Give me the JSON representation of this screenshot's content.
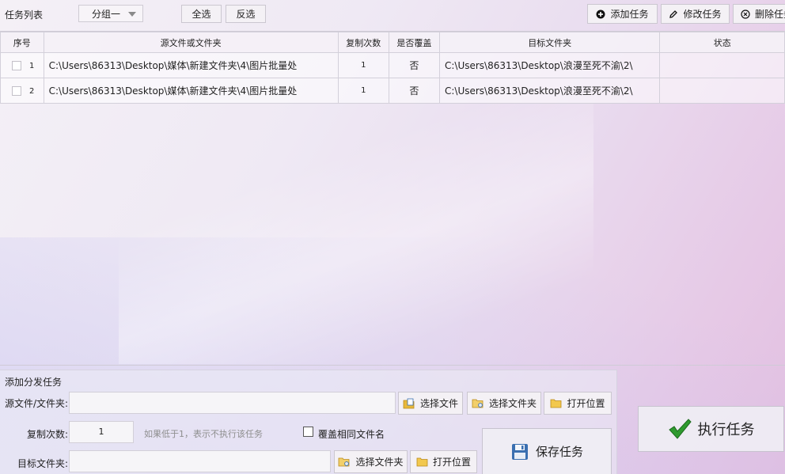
{
  "toolbar": {
    "title": "任务列表",
    "group_value": "分组一",
    "select_all": "全选",
    "invert_select": "反选",
    "add_task": "添加任务",
    "edit_task": "修改任务",
    "delete_task": "删除任务"
  },
  "table": {
    "columns": [
      "序号",
      "源文件或文件夹",
      "复制次数",
      "是否覆盖",
      "目标文件夹",
      "状态"
    ],
    "rows": [
      {
        "index": "1",
        "source": "C:\\Users\\86313\\Desktop\\媒体\\新建文件夹\\4\\图片批量处",
        "copies": "1",
        "overwrite": "否",
        "target": "C:\\Users\\86313\\Desktop\\浪漫至死不渝\\2\\",
        "status": ""
      },
      {
        "index": "2",
        "source": "C:\\Users\\86313\\Desktop\\媒体\\新建文件夹\\4\\图片批量处",
        "copies": "1",
        "overwrite": "否",
        "target": "C:\\Users\\86313\\Desktop\\浪漫至死不渝\\2\\",
        "status": ""
      }
    ]
  },
  "form": {
    "title": "添加分发任务",
    "source_label": "源文件/文件夹:",
    "source_value": "",
    "choose_file": "选择文件",
    "choose_folder": "选择文件夹",
    "open_location": "打开位置",
    "copies_label": "复制次数:",
    "copies_value": "1",
    "copies_hint": "如果低于1，表示不执行该任务",
    "overwrite_label": "覆盖相同文件名",
    "target_label": "目标文件夹:",
    "target_value": "",
    "target_choose_folder": "选择文件夹",
    "target_open_location": "打开位置",
    "save_task": "保存任务"
  },
  "execute": {
    "label": "执行任务"
  },
  "colors": {
    "accent_green": "#2f9a2f",
    "folder_yellow": "#e8b83a",
    "save_blue": "#3a6fb0"
  }
}
